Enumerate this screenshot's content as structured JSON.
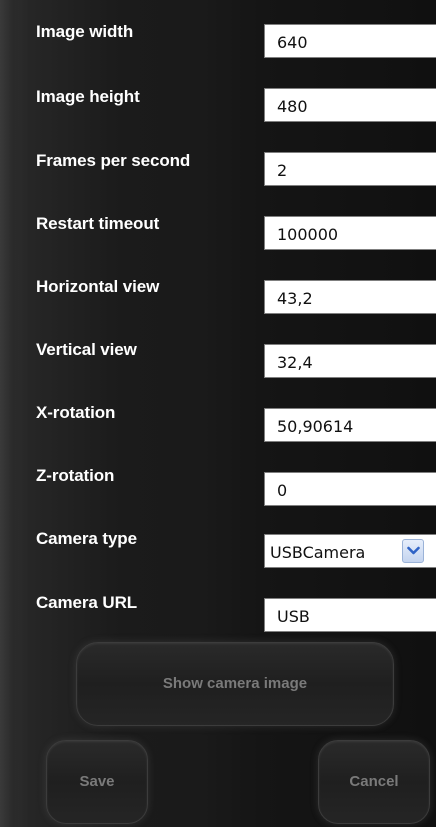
{
  "form": {
    "rows": [
      {
        "label": "Image width",
        "value": "640"
      },
      {
        "label": "Image height",
        "value": "480"
      },
      {
        "label": "Frames per second",
        "value": "2"
      },
      {
        "label": "Restart timeout",
        "value": "100000"
      },
      {
        "label": "Horizontal view",
        "value": "43,2"
      },
      {
        "label": "Vertical view",
        "value": "32,4"
      },
      {
        "label": "X-rotation",
        "value": "50,90614"
      },
      {
        "label": "Z-rotation",
        "value": "0"
      }
    ],
    "camera_type": {
      "label": "Camera type",
      "selected": "USBCamera"
    },
    "camera_url": {
      "label": "Camera URL",
      "value": "USB"
    }
  },
  "buttons": {
    "show_camera_image": "Show camera image",
    "save": "Save",
    "cancel": "Cancel"
  },
  "icons": {
    "dropdown": "chevron-down-icon"
  },
  "colors": {
    "label_text": "#ffffff",
    "button_text": "#7a7a7a",
    "dropdown_arrow": "#2f63c6"
  }
}
